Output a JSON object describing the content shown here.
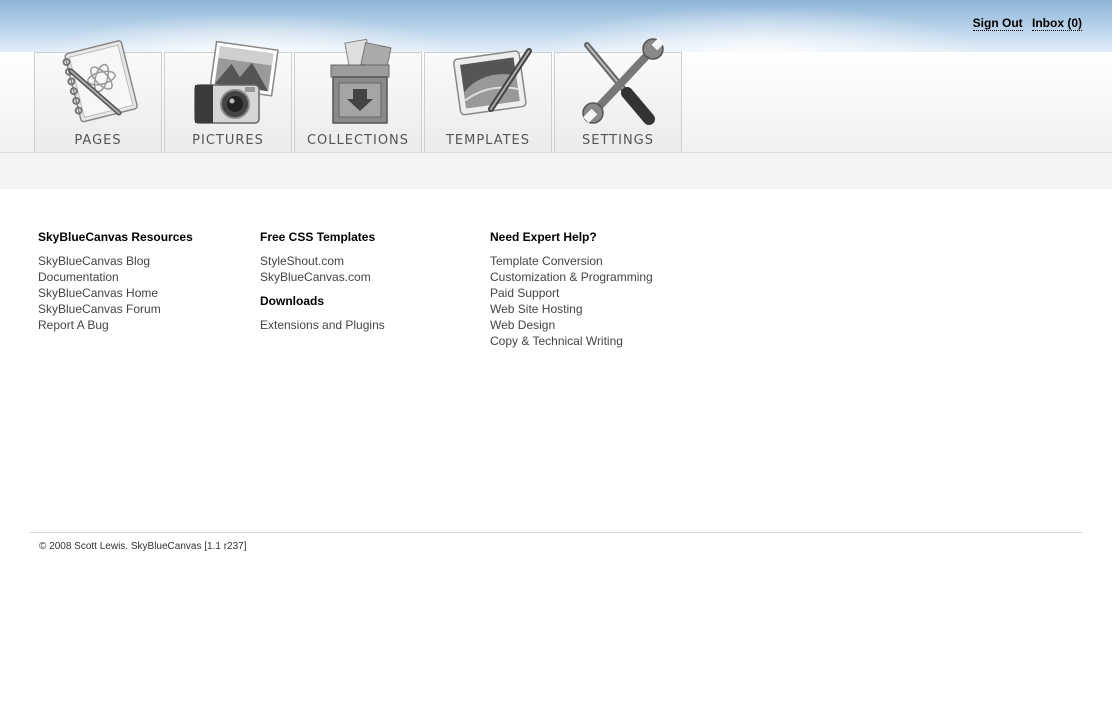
{
  "header": {
    "sign_out": "Sign Out",
    "inbox": "Inbox (0)"
  },
  "nav": {
    "tabs": [
      {
        "label": "PAGES",
        "icon": "notebook-pen-icon"
      },
      {
        "label": "PICTURES",
        "icon": "camera-photo-icon"
      },
      {
        "label": "COLLECTIONS",
        "icon": "storage-box-icon"
      },
      {
        "label": "TEMPLATES",
        "icon": "tablet-pen-icon"
      },
      {
        "label": "SETTINGS",
        "icon": "wrench-screwdriver-icon"
      }
    ]
  },
  "columns": {
    "resources": {
      "heading": "SkyBlueCanvas Resources",
      "links": [
        "SkyBlueCanvas Blog",
        "Documentation",
        "SkyBlueCanvas Home",
        "SkyBlueCanvas Forum",
        "Report A Bug"
      ]
    },
    "templates": {
      "heading": "Free CSS Templates",
      "links": [
        "StyleShout.com",
        "SkyBlueCanvas.com"
      ],
      "downloads_heading": "Downloads",
      "downloads_links": [
        "Extensions and Plugins"
      ]
    },
    "help": {
      "heading": "Need Expert Help?",
      "links": [
        "Template Conversion",
        "Customization & Programming",
        "Paid Support",
        "Web Site Hosting",
        "Web Design",
        "Copy & Technical Writing"
      ]
    }
  },
  "footer": {
    "text": "© 2008 Scott Lewis. SkyBlueCanvas [1.1 r237]"
  }
}
